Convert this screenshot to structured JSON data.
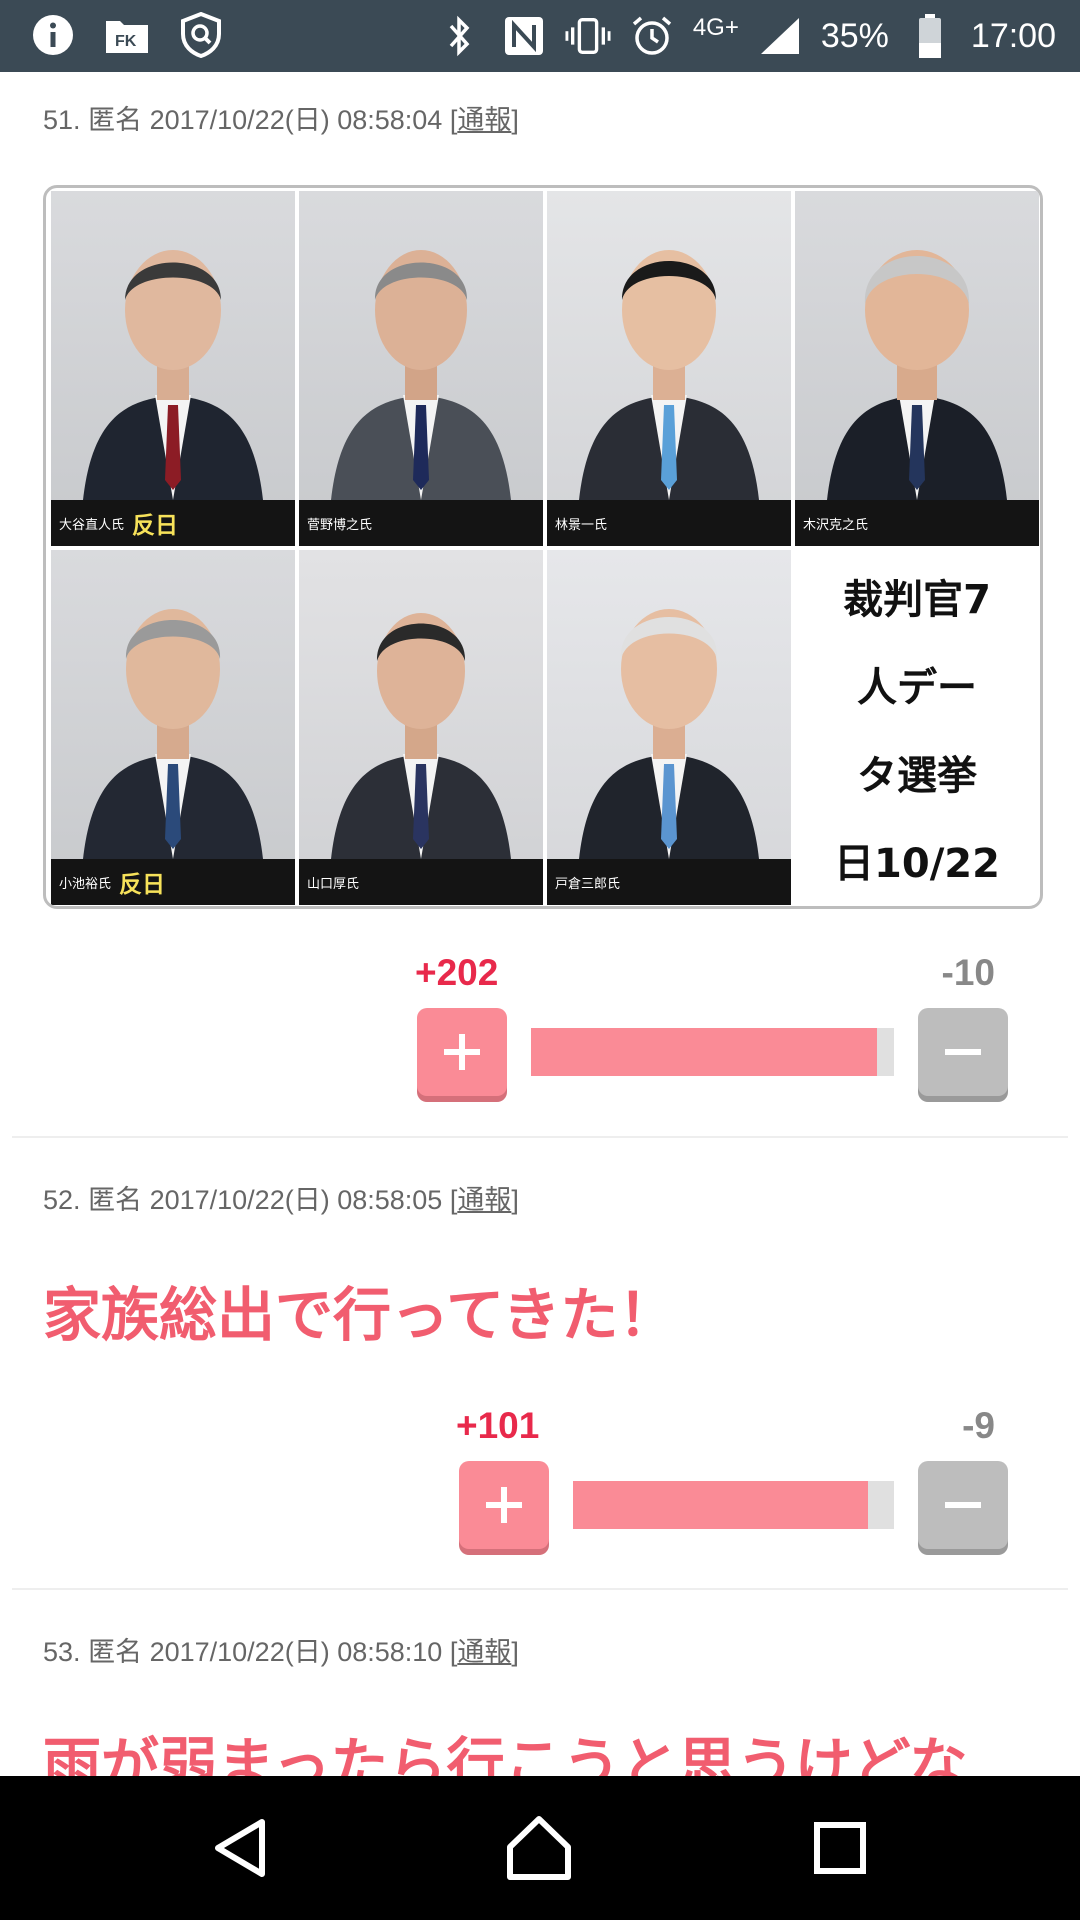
{
  "status_bar": {
    "left_icons": [
      "info-icon",
      "news-app-icon",
      "shield-search-icon"
    ],
    "network": "4G+",
    "battery": "35%",
    "time": "17:00"
  },
  "comments": [
    {
      "meta": {
        "number": "51.",
        "author": "匿名",
        "datetime": "2017/10/22(日) 08:58:04",
        "report_open": "[",
        "report": "通報",
        "report_close": "]"
      },
      "image": {
        "captions": [
          {
            "name": "大谷直人氏",
            "tag": "反日"
          },
          {
            "name": "菅野博之氏",
            "tag": ""
          },
          {
            "name": "林景一氏",
            "tag": ""
          },
          {
            "name": "木沢克之氏",
            "tag": ""
          },
          {
            "name": "小池裕氏",
            "tag": "反日"
          },
          {
            "name": "山口厚氏",
            "tag": ""
          },
          {
            "name": "戸倉三郎氏",
            "tag": ""
          }
        ],
        "text_lines": [
          "裁判官7",
          "人デー",
          "タ選挙",
          "日10/22"
        ]
      },
      "votes": {
        "plus": "+202",
        "minus": "-10",
        "ratio": 0.953
      }
    },
    {
      "meta": {
        "number": "52.",
        "author": "匿名",
        "datetime": "2017/10/22(日) 08:58:05",
        "report_open": "[",
        "report": "通報",
        "report_close": "]"
      },
      "text": "家族総出で行ってきた！",
      "votes": {
        "plus": "+101",
        "minus": "-9",
        "ratio": 0.918
      }
    },
    {
      "meta": {
        "number": "53.",
        "author": "匿名",
        "datetime": "2017/10/22(日) 08:58:10",
        "report_open": "[",
        "report": "通報",
        "report_close": "]"
      },
      "text": "雨が弱まったら行こうと思うけどな"
    }
  ],
  "colors": {
    "status_bar": "#3b4a55",
    "plus": "#fa8b96",
    "plus_count": "#e8294b",
    "minus": "#bdbdbd",
    "body_text": "#f15d6f"
  }
}
